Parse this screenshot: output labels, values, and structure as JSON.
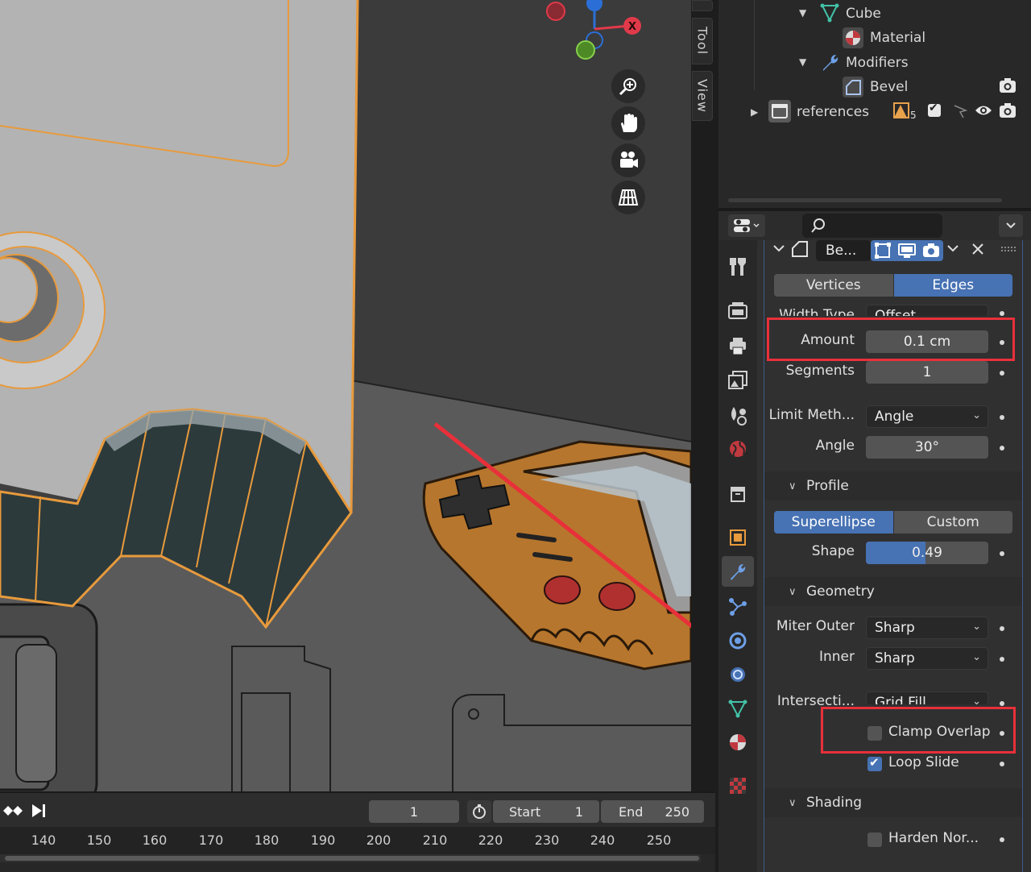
{
  "viewport": {
    "side_tabs": [
      "Tool",
      "View"
    ],
    "nav_icons": [
      "zoom-icon",
      "hand-pan-icon",
      "camera-icon",
      "grid-icon"
    ],
    "gizmo_x_label": "X"
  },
  "timeline": {
    "current_frame": "1",
    "start_label": "Start",
    "start_value": "1",
    "end_label": "End",
    "end_value": "250",
    "ticks": [
      "140",
      "150",
      "160",
      "170",
      "180",
      "190",
      "200",
      "210",
      "220",
      "230",
      "240",
      "250"
    ]
  },
  "outliner": {
    "items": [
      {
        "label": "Cube",
        "icon": "mesh-icon"
      },
      {
        "label": "Material",
        "icon": "material-icon"
      },
      {
        "label": "Modifiers",
        "icon": "wrench-icon"
      },
      {
        "label": "Bevel",
        "icon": "bevel-icon"
      },
      {
        "label": "references",
        "icon": "collection-icon",
        "badge": "5"
      }
    ]
  },
  "properties": {
    "modifier_name": "Be...",
    "affect_tabs": [
      "Vertices",
      "Edges"
    ],
    "affect_selected": "Edges",
    "width_type_label": "Width Type",
    "width_type_value": "Offset",
    "amount_label": "Amount",
    "amount_value": "0.1 cm",
    "segments_label": "Segments",
    "segments_value": "1",
    "limit_method_label": "Limit Meth...",
    "limit_method_value": "Angle",
    "angle_label": "Angle",
    "angle_value": "30°",
    "profile_header": "Profile",
    "profile_tabs": [
      "Superellipse",
      "Custom"
    ],
    "profile_selected": "Superellipse",
    "shape_label": "Shape",
    "shape_value": "0.49",
    "shape_fraction": 0.49,
    "geometry_header": "Geometry",
    "miter_outer_label": "Miter Outer",
    "miter_outer_value": "Sharp",
    "inner_label": "Inner",
    "inner_value": "Sharp",
    "intersection_label": "Intersecti...",
    "intersection_value": "Grid Fill",
    "clamp_overlap_label": "Clamp Overlap",
    "clamp_overlap_checked": false,
    "loop_slide_label": "Loop Slide",
    "loop_slide_checked": true,
    "shading_header": "Shading",
    "harden_normals_label": "Harden Nor...",
    "harden_normals_checked": false
  },
  "colors": {
    "accent": "#4772b3",
    "selection_orange": "#e89a3c",
    "annotation_red": "#e8303a"
  }
}
